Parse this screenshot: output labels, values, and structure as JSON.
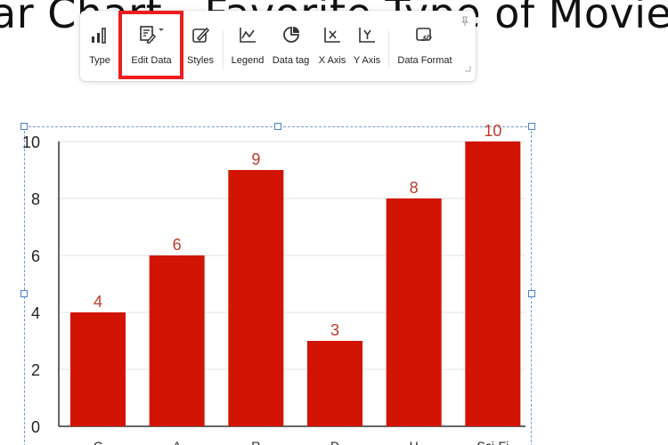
{
  "document": {
    "title_text": "ar Chart - Favorite Type of Movie"
  },
  "toolbar": {
    "buttons": [
      {
        "label": "Type",
        "icon": "bar-chart-icon"
      },
      {
        "label": "Edit Data",
        "icon": "edit-data-icon",
        "highlighted": true
      },
      {
        "label": "Styles",
        "icon": "styles-brush-icon"
      },
      {
        "label": "Legend",
        "icon": "legend-icon"
      },
      {
        "label": "Data tag",
        "icon": "data-tag-icon"
      },
      {
        "label": "X Axis",
        "icon": "x-axis-icon"
      },
      {
        "label": "Y Axis",
        "icon": "y-axis-icon"
      },
      {
        "label": "Data Format",
        "icon": "data-format-icon"
      }
    ],
    "pin_icon": "pin-icon"
  },
  "colors": {
    "bar": "#d21404",
    "data_label": "#c0392b",
    "highlight": "#ee1c1c",
    "selection": "#4a7fcf"
  },
  "chart_data": {
    "type": "bar",
    "categories": [
      "Comedy",
      "Action",
      "Romance",
      "Drama",
      "Horror",
      "Sci-Fi"
    ],
    "visible_category_text": [
      "C",
      "A",
      "R",
      "D",
      "H",
      "Sci-Fi"
    ],
    "values": [
      4,
      6,
      9,
      3,
      8,
      10
    ],
    "ylim": [
      0,
      10
    ],
    "yticks": [
      0,
      2,
      4,
      6,
      8,
      10
    ],
    "grid": true,
    "data_labels": true
  }
}
